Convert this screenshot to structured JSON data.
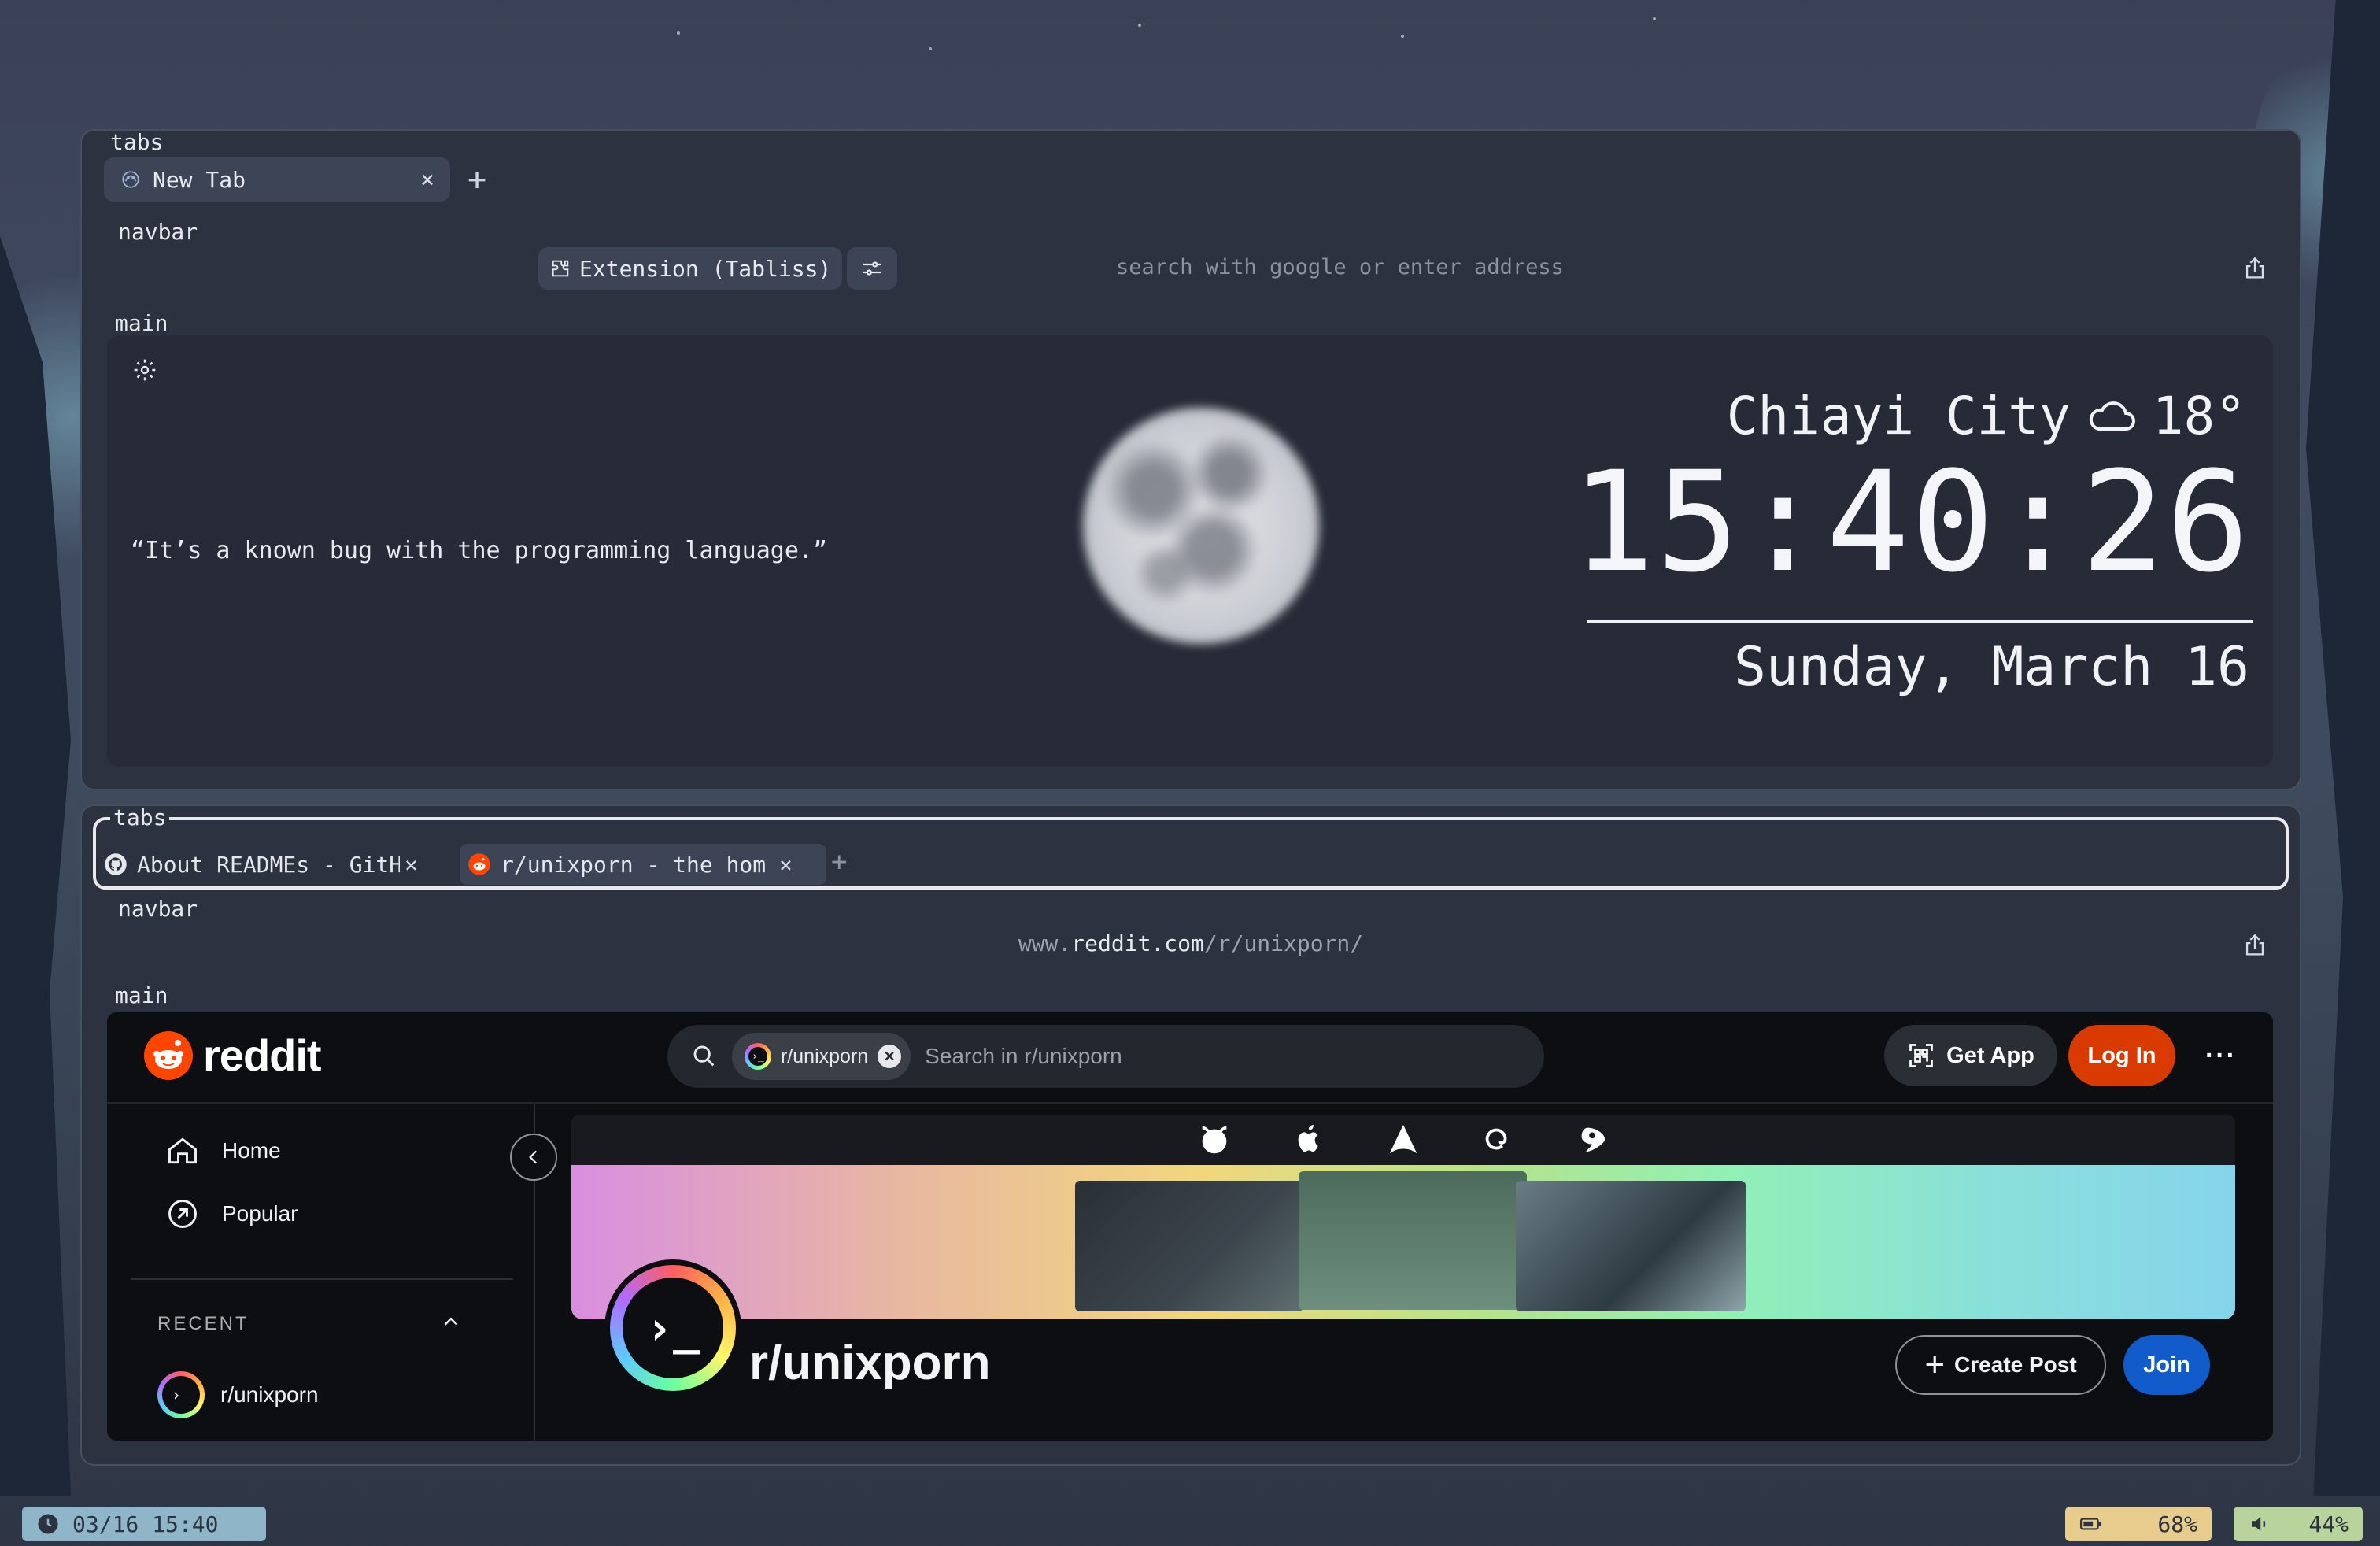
{
  "window_top": {
    "labels": {
      "tabs": "tabs",
      "navbar": "navbar",
      "main": "main"
    },
    "tab": {
      "title": "New Tab",
      "close": "×"
    },
    "new_tab": "+",
    "extension_chip": "Extension (Tabliss)",
    "address_placeholder": "search with google or enter address",
    "newtab_page": {
      "quote": "“It’s a known bug with the programming language.”",
      "location": "Chiayi City",
      "temperature": "18°",
      "time": "15:40:26",
      "date": "Sunday, March 16"
    }
  },
  "window_bottom": {
    "labels": {
      "tabs": "tabs",
      "navbar": "navbar",
      "main": "main"
    },
    "tabs": [
      {
        "title": "About READMEs - GitH",
        "close": "×"
      },
      {
        "title": "r/unixporn - the hom",
        "close": "×"
      }
    ],
    "new_tab": "+",
    "url": {
      "prefix": "www.",
      "domain": "reddit.com",
      "path": "/r/unixporn/"
    },
    "reddit": {
      "brand": "reddit",
      "search_scope": "r/unixporn",
      "search_placeholder": "Search in r/unixporn",
      "get_app": "Get App",
      "log_in": "Log In",
      "more": "···",
      "sidebar": {
        "items": [
          {
            "label": "Home"
          },
          {
            "label": "Popular"
          }
        ],
        "recent_label": "RECENT",
        "recent_items": [
          {
            "label": "r/unixporn"
          }
        ]
      },
      "subreddit": {
        "name": "r/unixporn",
        "avatar_text": "›_",
        "create_post": "Create Post",
        "join": "Join"
      }
    }
  },
  "statusbar": {
    "clock": "03/16 15:40",
    "battery": "68%",
    "volume": "44%"
  },
  "colors": {
    "window_bg": "#2d3241",
    "reddit_orange": "#d93a00",
    "join_blue": "#115bca",
    "status_clock": "#8fb6c8",
    "status_battery": "#e8cc8e",
    "status_volume": "#b8d49c"
  }
}
